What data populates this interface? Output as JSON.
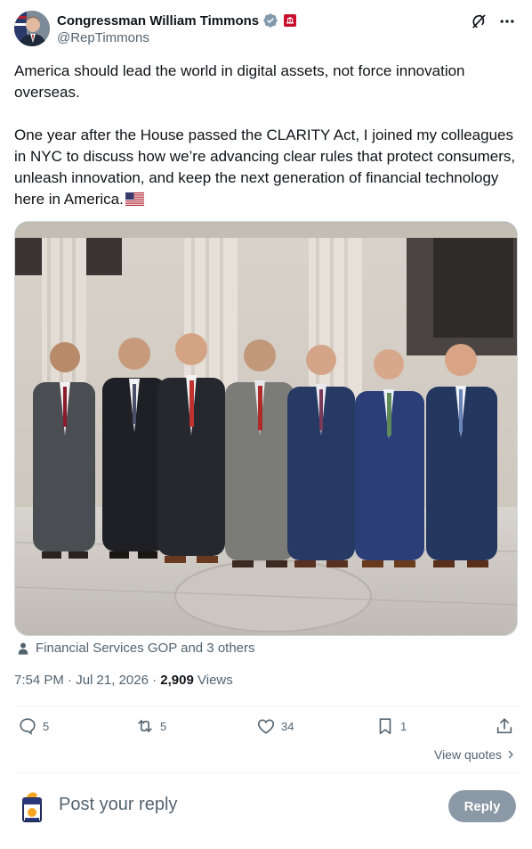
{
  "author": {
    "display_name": "Congressman William Timmons",
    "handle": "@RepTimmons",
    "avatar_icon": "profile-photo",
    "verified_color": "#829aab",
    "gov_badge_color": "#c8102e"
  },
  "tweet": {
    "paragraph_1": "America should lead the world in digital assets, not force innovation overseas.",
    "paragraph_2": "One year after the House passed the CLARITY Act, I joined my colleagues in NYC to discuss how we’re advancing clear rules that protect consumers, unleash innovation, and keep the next generation of financial technology here in America.",
    "emoji": "us-flag"
  },
  "tagged": {
    "text": "Financial Services GOP and 3 others"
  },
  "meta": {
    "time": "7:54 PM",
    "sep1": " · ",
    "date": "Jul 21, 2026",
    "sep2": " · ",
    "views_count": "2,909",
    "views_label": " Views"
  },
  "actions": {
    "replies": "5",
    "reposts": "5",
    "likes": "34",
    "bookmarks": "1"
  },
  "view_quotes": "View quotes",
  "composer": {
    "placeholder": "Post your reply",
    "reply_label": "Reply"
  },
  "colors": {
    "text_primary": "#0f1419",
    "text_secondary": "#536471",
    "reply_button_disabled": "#8b98a5"
  }
}
